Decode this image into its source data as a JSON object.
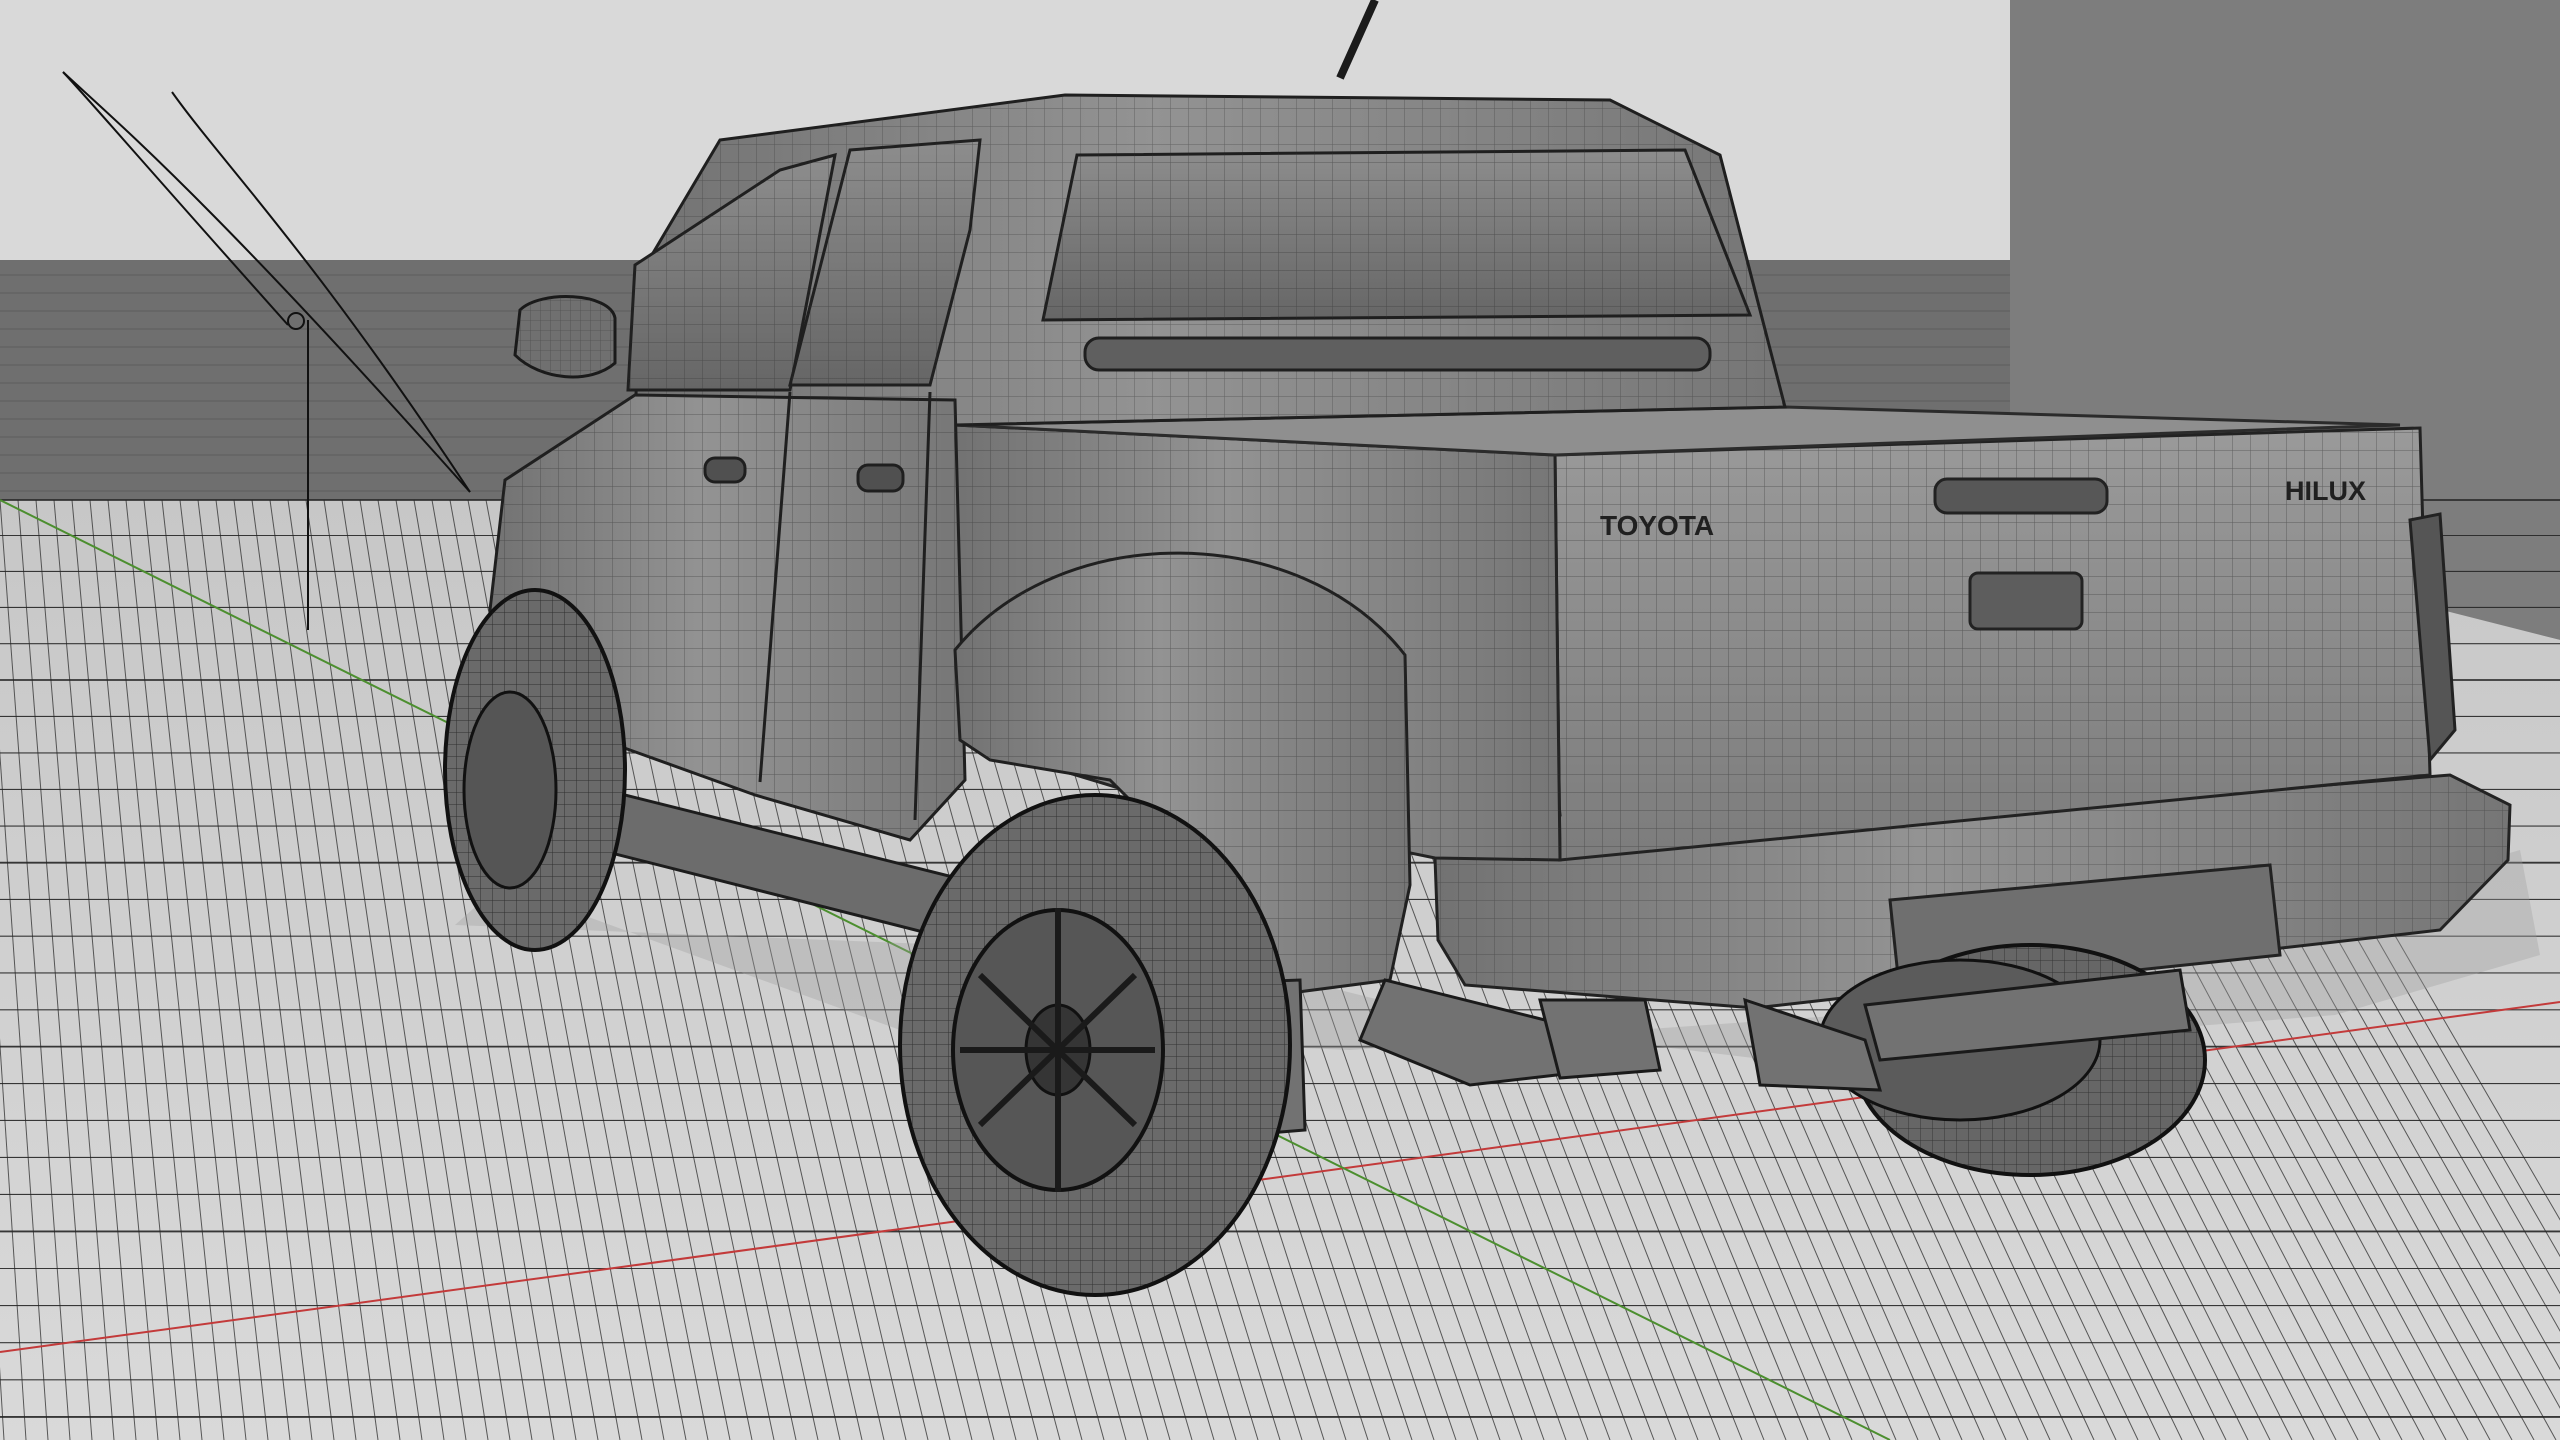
{
  "viewport": {
    "background_top": "#d9d9d9",
    "floor_color": "#d3d3d3",
    "grid_line_color": "#1f1f1f",
    "horizon_band_color": "#6f6f6f",
    "x_axis_color": "#c33a3a",
    "y_axis_color": "#4c8f2f",
    "wall_color": "#7d7d7d"
  },
  "vehicle": {
    "brand_badge": "TOYOTA",
    "model_badge": "HILUX",
    "body_color": "#8a8a8a",
    "wire_color": "#2f2f2f"
  },
  "scene": {
    "camera_icon": "camera-icon",
    "light_icon": "light-icon"
  }
}
